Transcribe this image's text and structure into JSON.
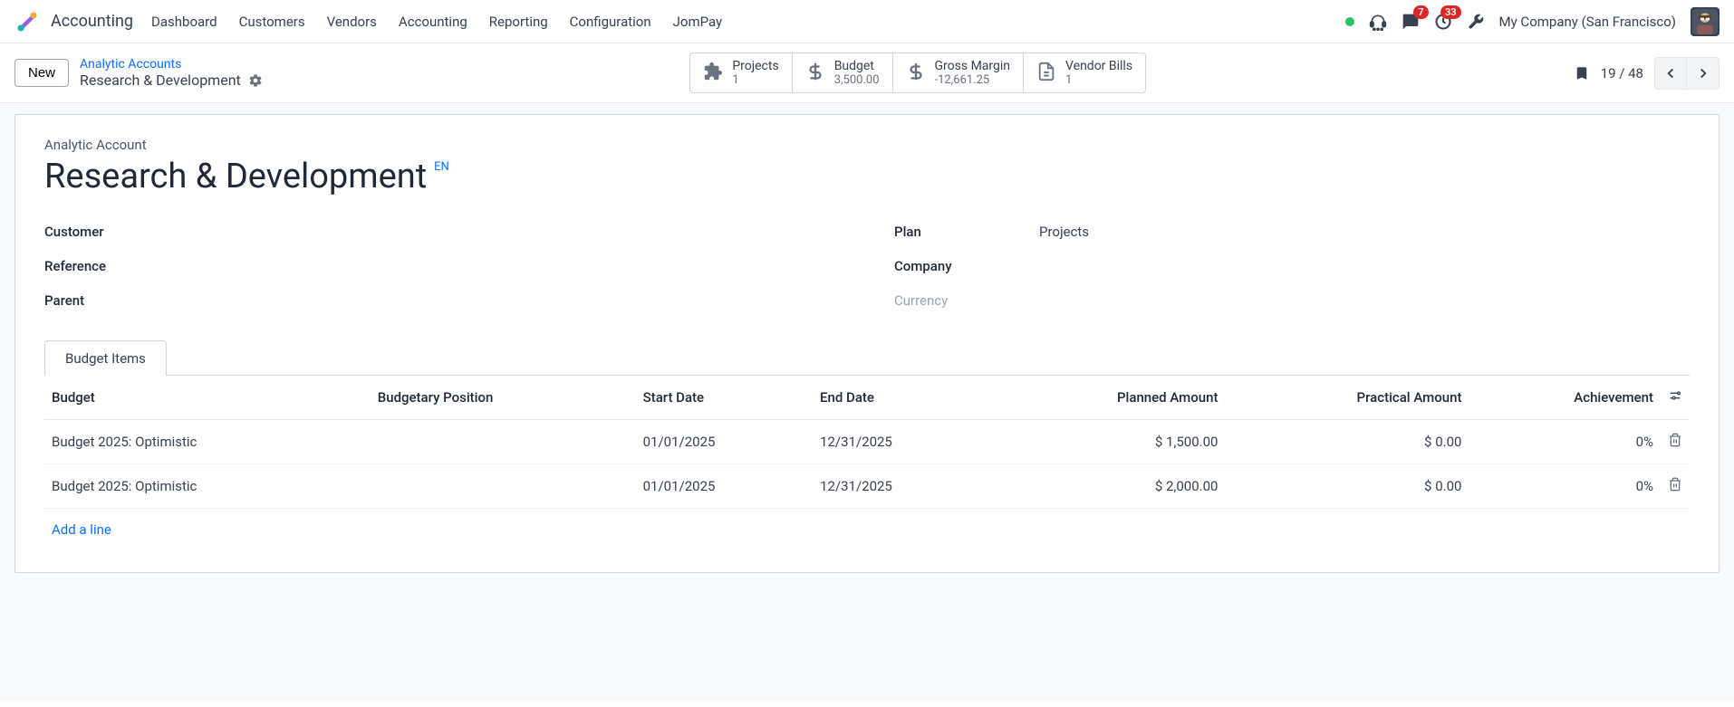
{
  "navbar": {
    "app_name": "Accounting",
    "links": [
      "Dashboard",
      "Customers",
      "Vendors",
      "Accounting",
      "Reporting",
      "Configuration",
      "JomPay"
    ],
    "messages_badge": "7",
    "activities_badge": "33",
    "company": "My Company (San Francisco)"
  },
  "controls": {
    "new_label": "New",
    "breadcrumb_parent": "Analytic Accounts",
    "breadcrumb_current": "Research & Development",
    "pager": "19 / 48"
  },
  "stats": [
    {
      "label": "Projects",
      "value": "1"
    },
    {
      "label": "Budget",
      "value": "3,500.00"
    },
    {
      "label": "Gross Margin",
      "value": "-12,661.25"
    },
    {
      "label": "Vendor Bills",
      "value": "1"
    }
  ],
  "form": {
    "section_label": "Analytic Account",
    "title": "Research & Development",
    "lang": "EN",
    "fields_left": [
      {
        "label": "Customer",
        "value": ""
      },
      {
        "label": "Reference",
        "value": ""
      },
      {
        "label": "Parent",
        "value": ""
      }
    ],
    "fields_right": [
      {
        "label": "Plan",
        "value": "Projects",
        "muted": false
      },
      {
        "label": "Company",
        "value": "",
        "muted": false
      },
      {
        "label": "Currency",
        "value": "",
        "muted": true
      }
    ]
  },
  "tabs": {
    "budget_items": "Budget Items"
  },
  "table": {
    "headers": {
      "budget": "Budget",
      "position": "Budgetary Position",
      "start": "Start Date",
      "end": "End Date",
      "planned": "Planned Amount",
      "practical": "Practical Amount",
      "achievement": "Achievement"
    },
    "rows": [
      {
        "budget": "Budget 2025: Optimistic",
        "position": "",
        "start": "01/01/2025",
        "end": "12/31/2025",
        "planned": "$ 1,500.00",
        "practical": "$ 0.00",
        "achievement": "0%"
      },
      {
        "budget": "Budget 2025: Optimistic",
        "position": "",
        "start": "01/01/2025",
        "end": "12/31/2025",
        "planned": "$ 2,000.00",
        "practical": "$ 0.00",
        "achievement": "0%"
      }
    ],
    "add_line": "Add a line"
  }
}
